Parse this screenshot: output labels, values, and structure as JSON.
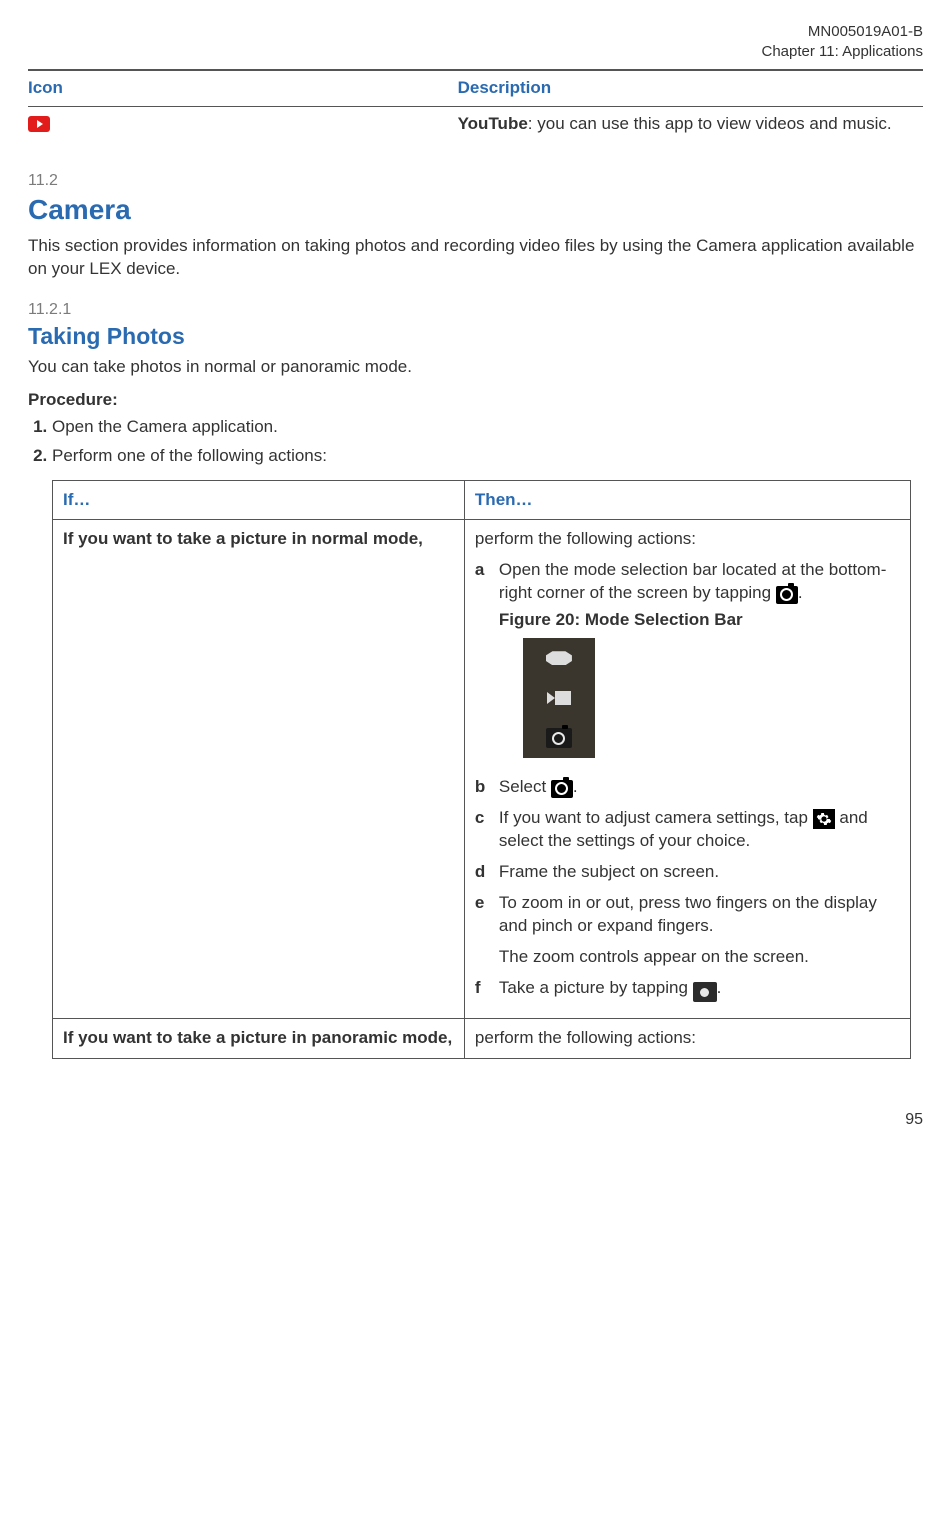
{
  "header": {
    "doc_id": "MN005019A01-B",
    "chapter": "Chapter 11:  Applications"
  },
  "icon_table": {
    "col_icon": "Icon",
    "col_desc": "Description",
    "row0": {
      "name_bold": "YouTube",
      "desc_rest": ": you can use this app to view videos and music."
    }
  },
  "sec112": {
    "num": "11.2",
    "title": "Camera",
    "body": "This section provides information on taking photos and recording video files by using the Camera application available on your LEX device."
  },
  "sec1121": {
    "num": "11.2.1",
    "title": "Taking Photos",
    "body": "You can take photos in normal or panoramic mode.",
    "proc_label": "Procedure:",
    "step1": "Open the Camera application.",
    "step2": "Perform one of the following actions:"
  },
  "ifthen": {
    "col_if": "If…",
    "col_then": "Then…",
    "row0": {
      "cond": "If you want to take a picture in normal mode,",
      "lead": "perform the following actions:",
      "a_pre": "Open the mode selection bar located at the bottom-right corner of the screen by tapping ",
      "a_post": ".",
      "fig_caption": "Figure 20: Mode Selection Bar",
      "b_pre": "Select ",
      "b_post": ".",
      "c_pre": "If you want to adjust camera settings, tap ",
      "c_post": " and select the settings of your choice.",
      "d": "Frame the subject on screen.",
      "e_1": "To zoom in or out, press two fingers on the display and pinch or expand fingers.",
      "e_2": "The zoom controls appear on the screen.",
      "f_pre": "Take a picture by tapping ",
      "f_post": "."
    },
    "row1": {
      "cond": "If you want to take a picture in panoramic mode,",
      "lead": "perform the following actions:"
    }
  },
  "letters": {
    "a": "a",
    "b": "b",
    "c": "c",
    "d": "d",
    "e": "e",
    "f": "f"
  },
  "page_num": "95"
}
